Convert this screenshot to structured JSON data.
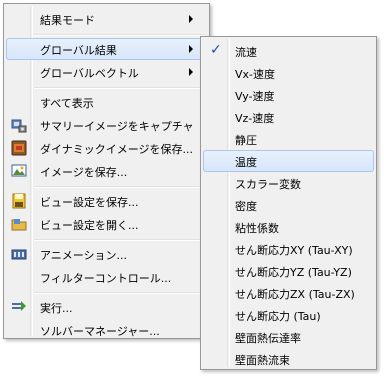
{
  "main_menu": {
    "items": [
      {
        "label": "結果モード",
        "submenu": true
      },
      {
        "label": "グローバル結果",
        "submenu": true,
        "highlighted": true
      },
      {
        "label": "グローバルベクトル",
        "submenu": true
      },
      {
        "label": "すべて表示"
      },
      {
        "label": "サマリーイメージをキャプチャ",
        "icon": "camera-icon"
      },
      {
        "label": "ダイナミックイメージを保存...",
        "icon": "film-icon"
      },
      {
        "label": "イメージを保存...",
        "icon": "image-icon"
      },
      {
        "label": "ビュー設定を保存...",
        "icon": "save-icon"
      },
      {
        "label": "ビュー設定を開く...",
        "icon": "folder-icon"
      },
      {
        "label": "アニメーション...",
        "icon": "animation-icon"
      },
      {
        "label": "フィルターコントロール..."
      },
      {
        "label": "実行...",
        "icon": "run-icon"
      },
      {
        "label": "ソルバーマネージャー..."
      }
    ]
  },
  "sub_menu": {
    "items": [
      {
        "label": "流速",
        "checked": true
      },
      {
        "label": "Vx-速度"
      },
      {
        "label": "Vy-速度"
      },
      {
        "label": "Vz-速度"
      },
      {
        "label": "静圧"
      },
      {
        "label": "温度",
        "highlighted": true
      },
      {
        "label": "スカラー変数"
      },
      {
        "label": "密度"
      },
      {
        "label": "粘性係数"
      },
      {
        "label": "せん断応力XY (Tau-XY)"
      },
      {
        "label": "せん断応力YZ (Tau-YZ)"
      },
      {
        "label": "せん断応力ZX (Tau-ZX)"
      },
      {
        "label": "せん断応力 (Tau)"
      },
      {
        "label": "壁面熱伝達率"
      },
      {
        "label": "壁面熱流束"
      }
    ]
  },
  "check_mark": "✓",
  "colors": {
    "highlight": "#d7e6f9",
    "highlight_border": "#a8c8ef",
    "menu_bg": "#f0f0f0"
  }
}
